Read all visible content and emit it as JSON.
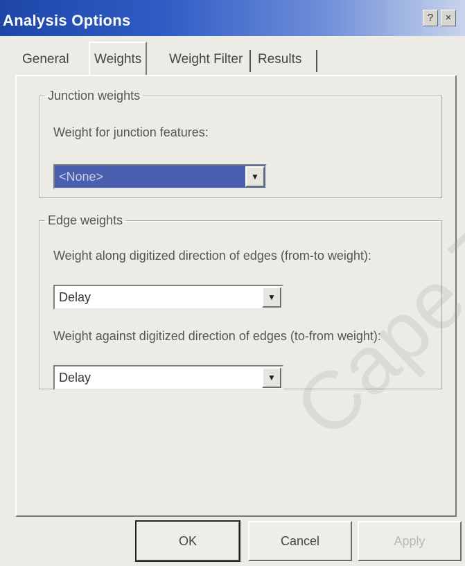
{
  "window": {
    "title": "Analysis Options",
    "help_button": "?",
    "close_button": "×"
  },
  "tabs": [
    {
      "label": "General",
      "active": false
    },
    {
      "label": "Weights",
      "active": true
    },
    {
      "label": "Weight Filter",
      "active": false
    },
    {
      "label": "Results",
      "active": false
    }
  ],
  "junction_weights": {
    "legend": "Junction weights",
    "label": "Weight for junction features:",
    "value": "<None>"
  },
  "edge_weights": {
    "legend": "Edge weights",
    "from_to_label": "Weight along digitized direction of edges (from-to weight):",
    "from_to_value": "Delay",
    "to_from_label": "Weight against digitized direction of edges (to-from weight):",
    "to_from_value": "Delay"
  },
  "buttons": {
    "ok": "OK",
    "cancel": "Cancel",
    "apply": "Apply"
  },
  "watermark": "Cape Town",
  "icons": {
    "dropdown": "chevron-down-icon"
  },
  "colors": {
    "title_bar": "#1e46a8",
    "selection": "#4a5fb0",
    "dialog_bg": "#ecebe6"
  }
}
